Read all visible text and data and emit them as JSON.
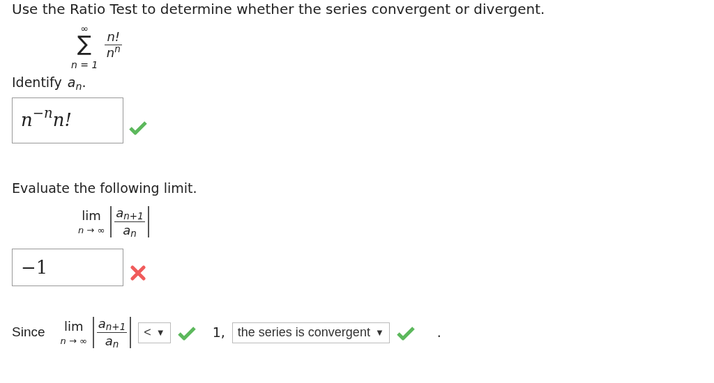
{
  "prompt": "Use the Ratio Test to determine whether the series convergent or divergent.",
  "series": {
    "upper": "∞",
    "sigma": "∑",
    "lower": "n = 1",
    "numerator": "n!",
    "denominator": "n$^{n}$"
  },
  "part_a": {
    "label": "Identify",
    "symbol": "a$_{n}$",
    "period": ".",
    "answer": "n$^{−n}$n!",
    "correct": true
  },
  "part_b": {
    "label": "Evaluate the following limit.",
    "limit": {
      "lim": "lim",
      "under": "n → ∞",
      "numerator": "a$_{n+1}$",
      "denominator": "a$_{n}$"
    },
    "answer": "−1",
    "correct": false
  },
  "conclusion": {
    "since": "Since",
    "limit": {
      "lim": "lim",
      "under": "n → ∞",
      "numerator": "a$_{n+1}$",
      "denominator": "a$_{n}$"
    },
    "comparison": {
      "value": "<",
      "arrow": "▼",
      "correct": true
    },
    "bound": "1,",
    "verdict": {
      "value": "the series is convergent",
      "arrow": "▼",
      "correct": true
    },
    "period": "."
  }
}
